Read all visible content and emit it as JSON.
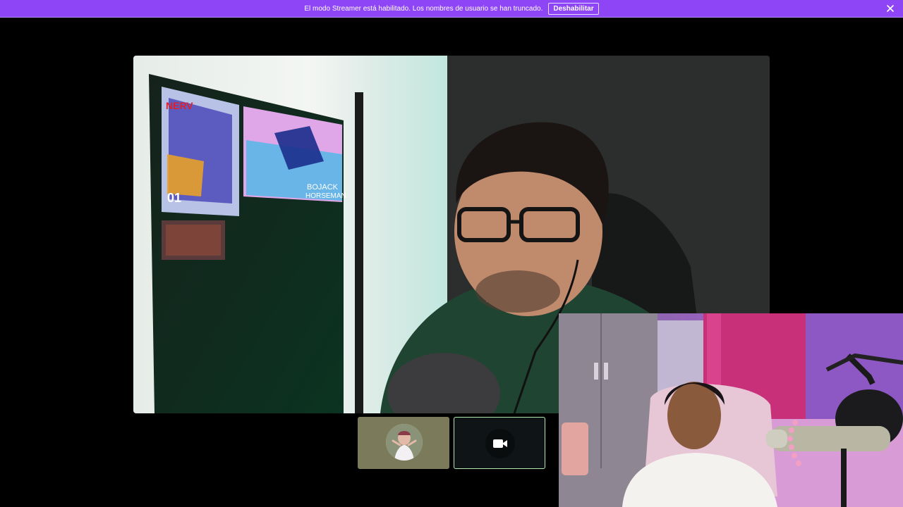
{
  "banner": {
    "message": "El modo Streamer está habilitado. Los nombres de usuario se han truncado.",
    "disable_label": "Deshabilitar"
  },
  "main_video": {
    "poster_top_text": "NERV",
    "poster_number": "01",
    "poster_right_title_line1": "BOJACK",
    "poster_right_title_line2": "HORSEMAN"
  },
  "colors": {
    "banner": "#8e45f5",
    "tile_active_border": "#b2e9b0",
    "tile_avatar_bg": "#7b7a5a"
  },
  "icons": [
    "close-icon",
    "camera-icon",
    "user-avatar"
  ]
}
